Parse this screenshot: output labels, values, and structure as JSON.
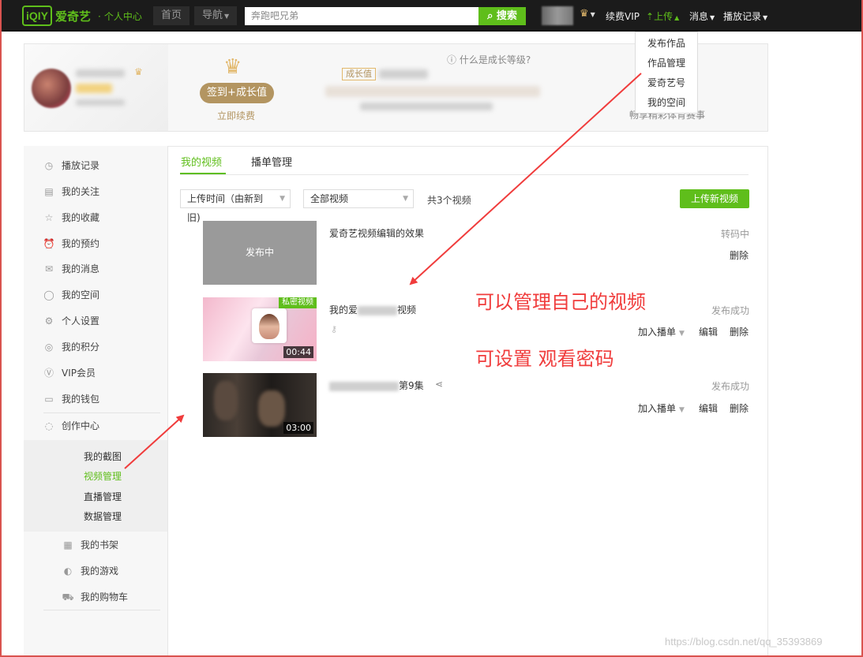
{
  "header": {
    "logo_mark": "iQIY",
    "logo_text": "爱奇艺",
    "logo_sub": "个人中心",
    "nav": [
      "首页",
      "导航"
    ],
    "search_placeholder": "奔跑吧兄弟",
    "search_button": "搜索",
    "links": {
      "vip": "续费VIP",
      "upload": "上传",
      "messages": "消息",
      "history": "播放记录"
    }
  },
  "upload_menu": [
    "发布作品",
    "作品管理",
    "爱奇艺号",
    "我的空间"
  ],
  "banner": {
    "sign_button": "签到+成长值",
    "renew": "立即续费",
    "what_level": "什么是成长等级?",
    "growth_badge": "成长值",
    "enjoy": "畅享精彩体育赛事"
  },
  "sidebar": {
    "items": [
      "播放记录",
      "我的关注",
      "我的收藏",
      "我的预约",
      "我的消息",
      "我的空间",
      "个人设置",
      "我的积分",
      "VIP会员",
      "我的钱包",
      "创作中心"
    ],
    "creation_sub": [
      "我的截图",
      "视频管理",
      "直播管理",
      "数据管理"
    ],
    "active_sub": "视频管理",
    "bottom_items": [
      "我的书架",
      "我的游戏",
      "我的购物车"
    ]
  },
  "main": {
    "tabs": [
      "我的视频",
      "播单管理"
    ],
    "active_tab": "我的视频",
    "sort_select": "上传时间（由新到",
    "sort_wrap": "旧)",
    "filter_select": "全部视频",
    "total": "共3个视频",
    "upload_button": "上传新视频",
    "videos": [
      {
        "title": "爱奇艺视频编辑的效果",
        "thumb_text": "发布中",
        "status": "转码中",
        "actions": [
          "删除"
        ]
      },
      {
        "title_prefix": "我的爱",
        "title_suffix": "视频",
        "tag": "私密视频",
        "duration": "00:44",
        "status": "发布成功",
        "actions": [
          "加入播单",
          "编辑",
          "删除"
        ]
      },
      {
        "title_suffix": "第9集",
        "duration": "03:00",
        "status": "发布成功",
        "actions": [
          "加入播单",
          "编辑",
          "删除"
        ]
      }
    ]
  },
  "annotations": {
    "manage": "可以管理自己的视频",
    "password": "可设置 观看密码"
  },
  "watermark": "https://blog.csdn.net/qq_35393869",
  "colors": {
    "brand_green": "#5fbe1b",
    "annotation_red": "#f03c3c",
    "gold": "#b39561"
  }
}
